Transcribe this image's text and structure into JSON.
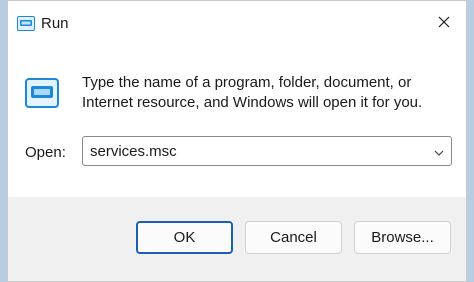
{
  "window": {
    "title": "Run",
    "title_icon": "run-icon",
    "close_icon": "close-icon"
  },
  "content": {
    "icon": "run-program-icon",
    "description_line1": "Type the name of a program, folder, document, or",
    "description_line2": "Internet resource, and Windows will open it for you.",
    "open_label": "Open:",
    "open_value": "services.msc",
    "dropdown_icon": "chevron-down-icon"
  },
  "buttons": {
    "ok": "OK",
    "cancel": "Cancel",
    "browse": "Browse..."
  },
  "colors": {
    "accent": "#1a5fb4",
    "icon_blue": "#1e88d8"
  }
}
